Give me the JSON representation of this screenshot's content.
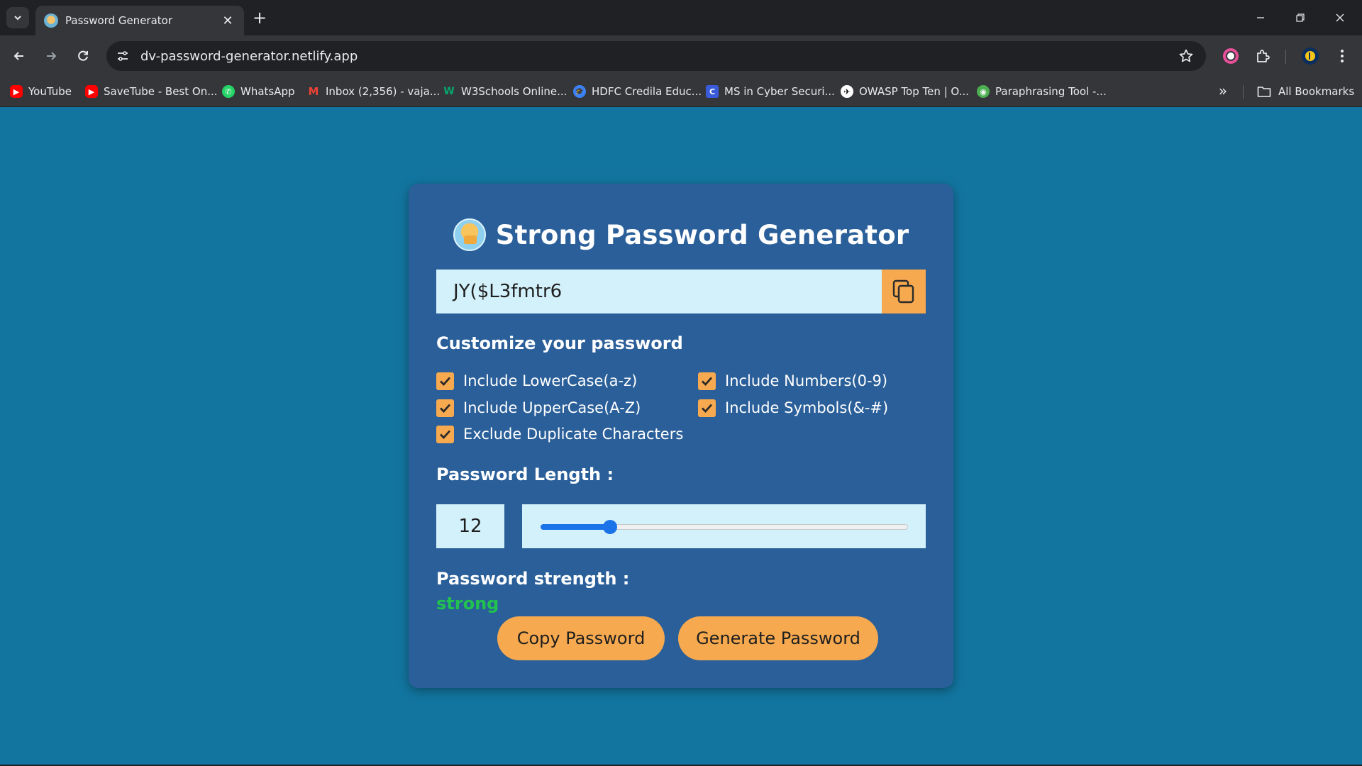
{
  "browser": {
    "tab_title": "Password Generator",
    "url": "dv-password-generator.netlify.app",
    "bookmarks": [
      {
        "label": "YouTube",
        "icon": "youtube-icon",
        "color": "#ff0000"
      },
      {
        "label": "SaveTube - Best On...",
        "icon": "savetube-icon",
        "color": "#ff0000"
      },
      {
        "label": "WhatsApp",
        "icon": "whatsapp-icon",
        "color": "#25d366"
      },
      {
        "label": "Inbox (2,356) - vaja...",
        "icon": "gmail-icon",
        "color": "#ea4335"
      },
      {
        "label": "W3Schools Online...",
        "icon": "w3schools-icon",
        "color": "#04aa6d"
      },
      {
        "label": "HDFC Credila Educ...",
        "icon": "hdfc-credila-icon",
        "color": "#3b82f6"
      },
      {
        "label": "MS in Cyber Securi...",
        "icon": "ms-cyber-icon",
        "color": "#3a5bd9"
      },
      {
        "label": "OWASP Top Ten | O...",
        "icon": "owasp-icon",
        "color": "#ffffff"
      },
      {
        "label": "Paraphrasing Tool -...",
        "icon": "paraphrasing-icon",
        "color": "#4caf50"
      }
    ],
    "all_bookmarks_label": "All Bookmarks"
  },
  "app": {
    "title": "Strong Password Generator",
    "password": "JY($L3fmtr6",
    "customize_label": "Customize your password",
    "options": [
      {
        "label": "Include LowerCase(a-z)",
        "checked": true
      },
      {
        "label": "Include Numbers(0-9)",
        "checked": true
      },
      {
        "label": "Include UpperCase(A-Z)",
        "checked": true
      },
      {
        "label": "Include Symbols(&-#)",
        "checked": true
      },
      {
        "label": "Exclude Duplicate Characters",
        "checked": true
      }
    ],
    "length_label": "Password Length :",
    "length_value": "12",
    "slider_fraction": 0.19,
    "strength_label": "Password strength :",
    "strength_value": "strong",
    "copy_button": "Copy Password",
    "generate_button": "Generate Password"
  },
  "colors": {
    "page_bg": "#12759f",
    "card_bg": "#2a5f99",
    "accent": "#f6a94f",
    "input_bg": "#d3f1fb",
    "strength": "#21c24f",
    "slider": "#1a73e8"
  }
}
